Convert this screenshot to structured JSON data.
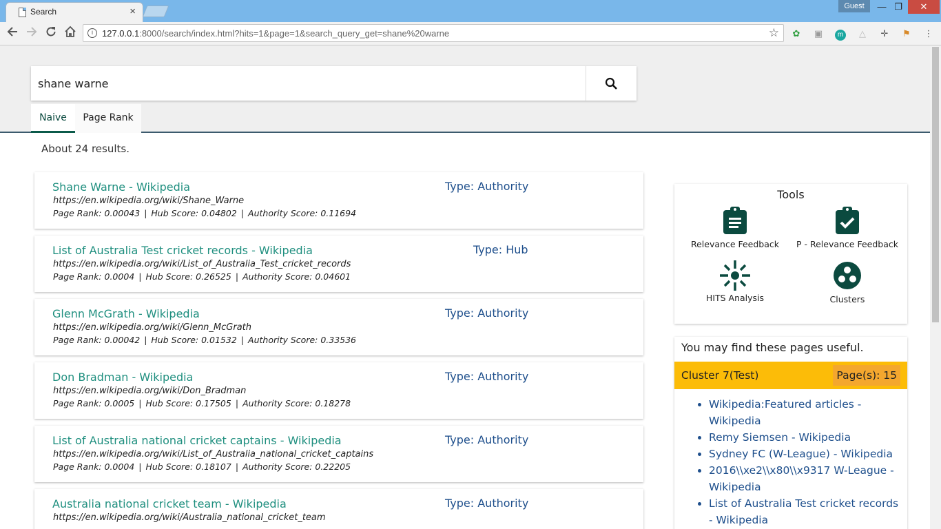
{
  "browser": {
    "tab_title": "Search",
    "tab_close": "×",
    "guest_label": "Guest",
    "url_host": "127.0.0.1",
    "url_rest": ":8000/search/index.html?hits=1&page=1&search_query_get=shane%20warne",
    "window_min": "—",
    "window_max": "❐",
    "window_close": "✕"
  },
  "search": {
    "query": "shane warne"
  },
  "tabs": {
    "naive": "Naive",
    "page_rank": "Page Rank"
  },
  "result_count": "About 24 results.",
  "results": [
    {
      "title": "Shane Warne - Wikipedia",
      "url": "https://en.wikipedia.org/wiki/Shane_Warne",
      "page_rank": "Page Rank: 0.00043",
      "hub": "Hub Score: 0.04802",
      "authority": "Authority Score: 0.11694",
      "type": "Type: Authority"
    },
    {
      "title": "List of Australia Test cricket records - Wikipedia",
      "url": "https://en.wikipedia.org/wiki/List_of_Australia_Test_cricket_records",
      "page_rank": "Page Rank: 0.0004",
      "hub": "Hub Score: 0.26525",
      "authority": "Authority Score: 0.04601",
      "type": "Type: Hub"
    },
    {
      "title": "Glenn McGrath - Wikipedia",
      "url": "https://en.wikipedia.org/wiki/Glenn_McGrath",
      "page_rank": "Page Rank: 0.00042",
      "hub": "Hub Score: 0.01532",
      "authority": "Authority Score: 0.33536",
      "type": "Type: Authority"
    },
    {
      "title": "Don Bradman - Wikipedia",
      "url": "https://en.wikipedia.org/wiki/Don_Bradman",
      "page_rank": "Page Rank: 0.0005",
      "hub": "Hub Score: 0.17505",
      "authority": "Authority Score: 0.18278",
      "type": "Type: Authority"
    },
    {
      "title": "List of Australia national cricket captains - Wikipedia",
      "url": "https://en.wikipedia.org/wiki/List_of_Australia_national_cricket_captains",
      "page_rank": "Page Rank: 0.0004",
      "hub": "Hub Score: 0.18107",
      "authority": "Authority Score: 0.22205",
      "type": "Type: Authority"
    },
    {
      "title": "Australia national cricket team - Wikipedia",
      "url": "https://en.wikipedia.org/wiki/Australia_national_cricket_team",
      "page_rank": "",
      "hub": "",
      "authority": "",
      "type": "Type: Authority"
    }
  ],
  "tools": {
    "title": "Tools",
    "items": [
      {
        "label": "Relevance Feedback",
        "icon": "clipboard-list-icon"
      },
      {
        "label": "P - Relevance Feedback",
        "icon": "clipboard-check-icon"
      },
      {
        "label": "HITS Analysis",
        "icon": "hits-icon"
      },
      {
        "label": "Clusters",
        "icon": "clusters-icon"
      }
    ]
  },
  "useful": {
    "heading": "You may find these pages useful.",
    "cluster_name": "Cluster 7(Test)",
    "cluster_pages": "Page(s): 15",
    "links": [
      "Wikipedia:Featured articles - Wikipedia",
      "Remy Siemsen - Wikipedia",
      "Sydney FC (W-League) - Wikipedia",
      "2016\\\\xe2\\\\x80\\\\x9317 W-League - Wikipedia",
      "List of Australia Test cricket records - Wikipedia"
    ]
  },
  "colors": {
    "accent": "#1f8f7f",
    "type_blue": "#1e4f8c",
    "cluster_yellow": "#fcbc08",
    "icon_green": "#0b4a3f"
  }
}
